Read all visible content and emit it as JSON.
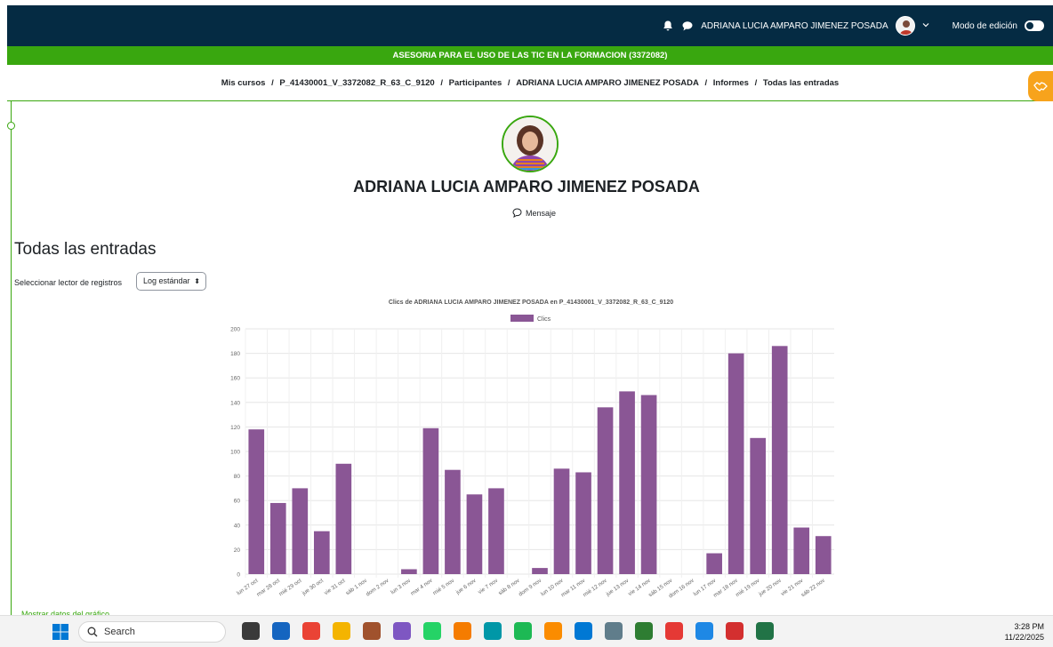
{
  "topbar": {
    "user_name": "ADRIANA LUCIA AMPARO JIMENEZ POSADA",
    "edit_mode_label": "Modo de edición",
    "bg_color": "#052b43"
  },
  "course": {
    "title": "ASESORIA PARA EL USO DE LAS TIC EN LA FORMACION (3372082)",
    "accent_color": "#39a70f"
  },
  "breadcrumb": {
    "items": [
      "Mis cursos",
      "P_41430001_V_3372082_R_63_C_9120",
      "Participantes",
      "ADRIANA LUCIA AMPARO JIMENEZ POSADA",
      "Informes",
      "Todas las entradas"
    ],
    "separator": "/"
  },
  "profile": {
    "name": "ADRIANA LUCIA AMPARO JIMENEZ POSADA",
    "message_label": "Mensaje"
  },
  "report": {
    "section_title": "Todas las entradas",
    "log_reader_label": "Seleccionar lector de registros",
    "log_reader_value": "Log estándar",
    "show_data_link": "Mostrar datos del gráfico"
  },
  "chart_data": {
    "type": "bar",
    "title": "Clics de ADRIANA LUCIA AMPARO JIMENEZ POSADA  en P_41430001_V_3372082_R_63_C_9120",
    "legend": [
      "Clics"
    ],
    "legend_position": "top",
    "bar_color": "#8a5695",
    "grid": true,
    "ylim": [
      0,
      200
    ],
    "yticks": [
      0,
      20,
      40,
      60,
      80,
      100,
      120,
      140,
      160,
      180,
      200
    ],
    "categories": [
      "lun 27 oct",
      "mar 28 oct",
      "mié 29 oct",
      "jue 30 oct",
      "vie 31 oct",
      "sáb 1 nov",
      "dom 2 nov",
      "lun 3 nov",
      "mar 4 nov",
      "mié 5 nov",
      "jue 6 nov",
      "vie 7 nov",
      "sáb 8 nov",
      "dom 9 nov",
      "lun 10 nov",
      "mar 11 nov",
      "mié 12 nov",
      "jue 13 nov",
      "vie 14 nov",
      "sáb 15 nov",
      "dom 16 nov",
      "lun 17 nov",
      "mar 18 nov",
      "mié 19 nov",
      "jue 20 nov",
      "vie 21 nov",
      "sáb 22 nov"
    ],
    "series": [
      {
        "name": "Clics",
        "values": [
          118,
          58,
          70,
          35,
          90,
          0,
          0,
          4,
          119,
          85,
          65,
          70,
          0,
          5,
          86,
          83,
          136,
          149,
          146,
          0,
          0,
          17,
          180,
          111,
          186,
          38,
          31
        ]
      }
    ]
  },
  "taskbar": {
    "search_placeholder": "Search",
    "time": "3:28 PM",
    "date": "11/22/2025",
    "app_colors": [
      "#3a3a3a",
      "#1565c0",
      "#ea4335",
      "#f4b400",
      "#a0522d",
      "#7e57c2",
      "#25d366",
      "#f57c00",
      "#0097a7",
      "#1db954",
      "#fb8c00",
      "#0078d4",
      "#607d8b",
      "#2e7d32",
      "#e53935",
      "#1e88e5",
      "#d32f2f",
      "#217346"
    ]
  }
}
